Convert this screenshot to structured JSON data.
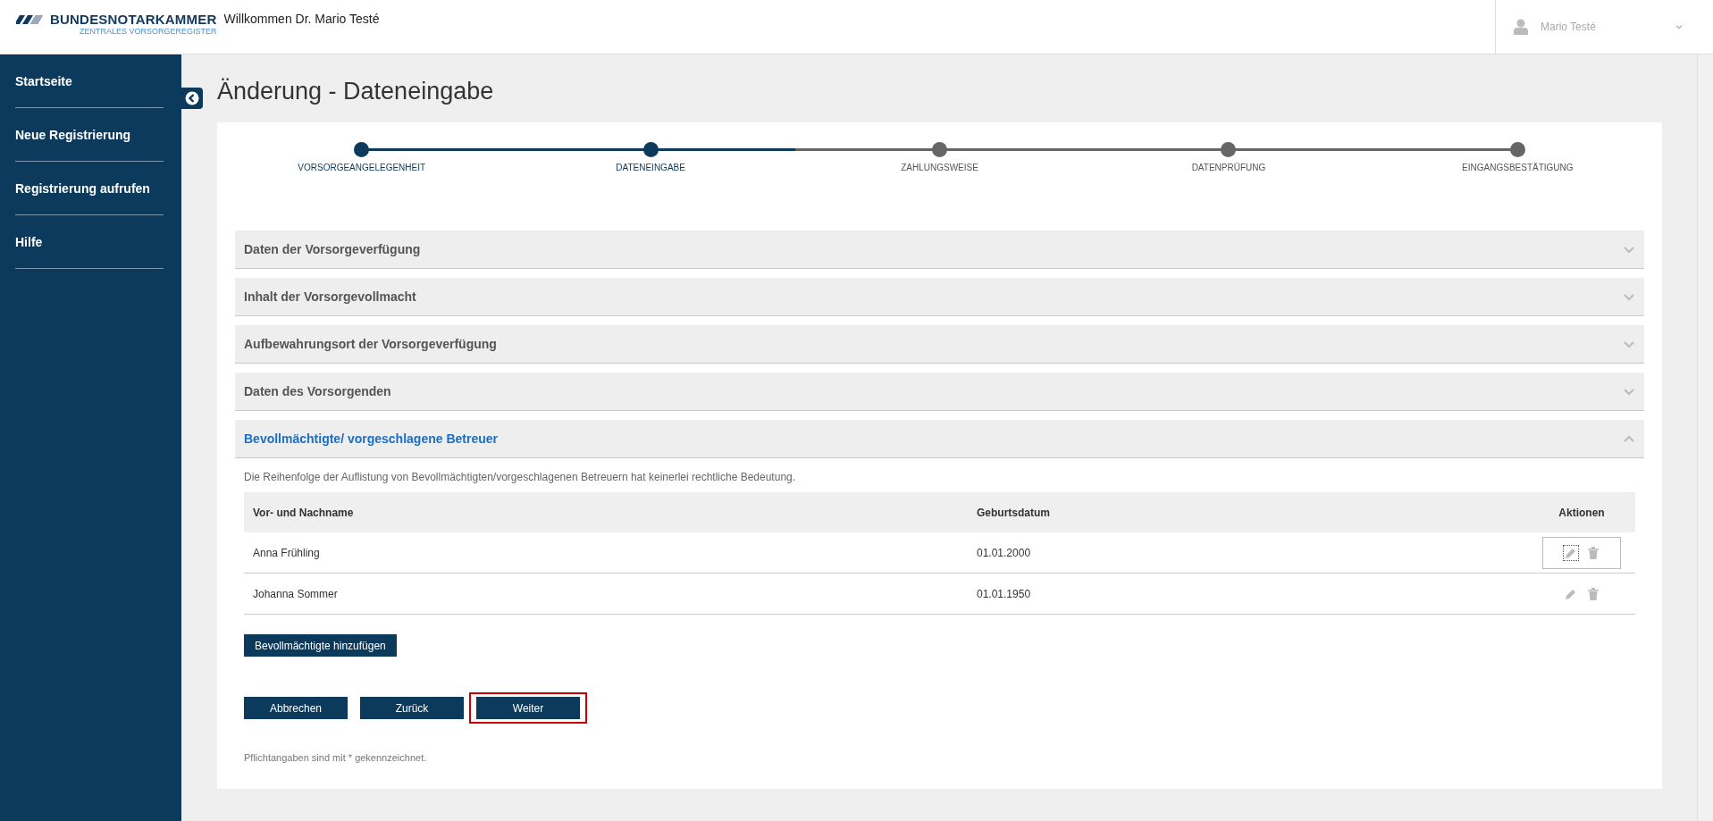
{
  "header": {
    "logo_name": "BUNDESNOTARKAMMER",
    "logo_subtitle": "ZENTRALES VORSORGEREGISTER",
    "welcome": "Willkommen Dr. Mario Testé",
    "user_name": "Mario Testé"
  },
  "sidebar": {
    "items": [
      {
        "label": "Startseite"
      },
      {
        "label": "Neue Registrierung"
      },
      {
        "label": "Registrierung aufrufen"
      },
      {
        "label": "Hilfe"
      }
    ]
  },
  "page_title": "Änderung - Dateneingabe",
  "stepper": [
    {
      "label": "VORSORGEANGELEGENHEIT",
      "done": true
    },
    {
      "label": "DATENEINGABE",
      "done": true
    },
    {
      "label": "ZAHLUNGSWEISE",
      "done": false
    },
    {
      "label": "DATENPRÜFUNG",
      "done": false
    },
    {
      "label": "EINGANGSBESTÄTIGUNG",
      "done": false
    }
  ],
  "sections": [
    {
      "title": "Daten der Vorsorgeverfügung",
      "expanded": false
    },
    {
      "title": "Inhalt der Vorsorgevollmacht",
      "expanded": false
    },
    {
      "title": "Aufbewahrungsort der Vorsorgeverfügung",
      "expanded": false
    },
    {
      "title": "Daten des Vorsorgenden",
      "expanded": false
    },
    {
      "title": "Bevollmächtigte/ vorgeschlagene Betreuer",
      "expanded": true
    }
  ],
  "note": "Die Reihenfolge der Auflistung von Bevollmächtigten/vorgeschlagenen Betreuern hat keinerlei rechtliche Bedeutung.",
  "table": {
    "columns": [
      "Vor- und Nachname",
      "Geburtsdatum",
      "Aktionen"
    ],
    "rows": [
      {
        "name": "Anna Frühling",
        "birthdate": "01.01.2000",
        "focused": true
      },
      {
        "name": "Johanna Sommer",
        "birthdate": "01.01.1950",
        "focused": false
      }
    ]
  },
  "add_button": "Bevollmächtigte hinzufügen",
  "buttons": [
    {
      "label": "Abbrechen",
      "highlighted": false
    },
    {
      "label": "Zurück",
      "highlighted": false
    },
    {
      "label": "Weiter",
      "highlighted": true
    }
  ],
  "footnote": "Pflichtangaben sind mit * gekennzeichnet."
}
